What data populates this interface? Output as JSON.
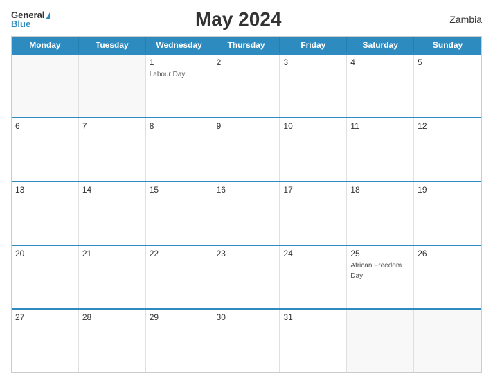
{
  "header": {
    "logo_general": "General",
    "logo_blue": "Blue",
    "title": "May 2024",
    "country": "Zambia"
  },
  "calendar": {
    "days_of_week": [
      "Monday",
      "Tuesday",
      "Wednesday",
      "Thursday",
      "Friday",
      "Saturday",
      "Sunday"
    ],
    "weeks": [
      [
        {
          "day": "",
          "empty": true
        },
        {
          "day": "",
          "empty": true
        },
        {
          "day": "1",
          "holiday": "Labour Day"
        },
        {
          "day": "2"
        },
        {
          "day": "3"
        },
        {
          "day": "4"
        },
        {
          "day": "5"
        }
      ],
      [
        {
          "day": "6"
        },
        {
          "day": "7"
        },
        {
          "day": "8"
        },
        {
          "day": "9"
        },
        {
          "day": "10"
        },
        {
          "day": "11"
        },
        {
          "day": "12"
        }
      ],
      [
        {
          "day": "13"
        },
        {
          "day": "14"
        },
        {
          "day": "15"
        },
        {
          "day": "16"
        },
        {
          "day": "17"
        },
        {
          "day": "18"
        },
        {
          "day": "19"
        }
      ],
      [
        {
          "day": "20"
        },
        {
          "day": "21"
        },
        {
          "day": "22"
        },
        {
          "day": "23"
        },
        {
          "day": "24"
        },
        {
          "day": "25",
          "holiday": "African Freedom Day"
        },
        {
          "day": "26"
        }
      ],
      [
        {
          "day": "27"
        },
        {
          "day": "28"
        },
        {
          "day": "29"
        },
        {
          "day": "30"
        },
        {
          "day": "31"
        },
        {
          "day": "",
          "empty": true
        },
        {
          "day": "",
          "empty": true
        }
      ]
    ]
  }
}
